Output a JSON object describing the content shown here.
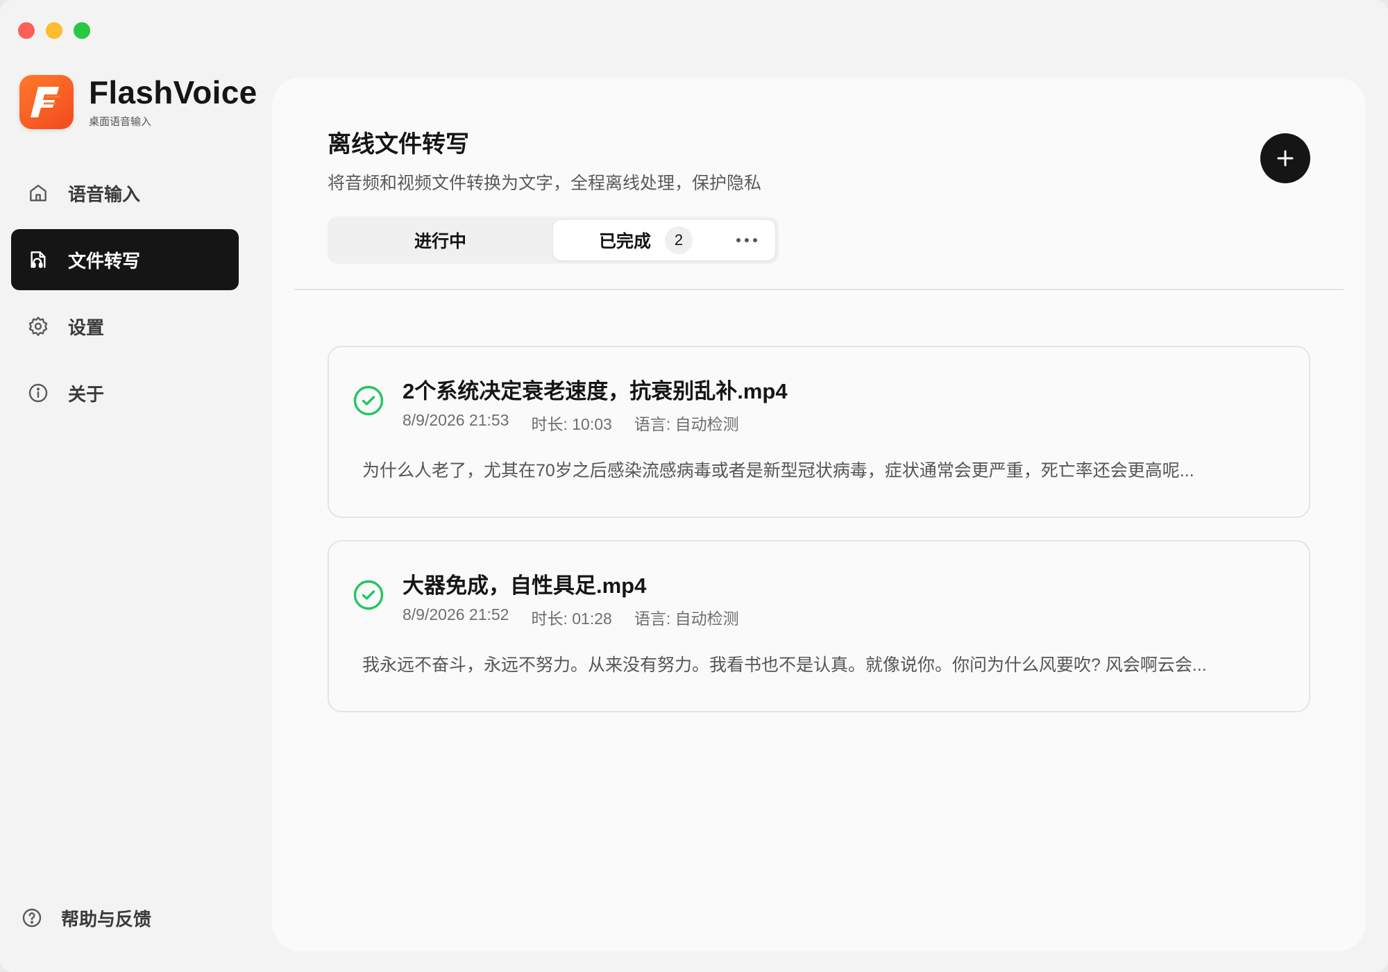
{
  "app": {
    "name": "FlashVoice",
    "tagline": "桌面语音输入"
  },
  "sidebar": {
    "items": [
      {
        "label": "语音输入",
        "icon": "home-icon",
        "active": false
      },
      {
        "label": "文件转写",
        "icon": "file-audio-icon",
        "active": true
      },
      {
        "label": "设置",
        "icon": "gear-icon",
        "active": false
      },
      {
        "label": "关于",
        "icon": "info-icon",
        "active": false
      }
    ],
    "help": {
      "label": "帮助与反馈",
      "icon": "help-icon"
    }
  },
  "main": {
    "title": "离线文件转写",
    "subtitle": "将音频和视频文件转换为文字，全程离线处理，保护隐私",
    "add_icon": "plus-icon",
    "tabs": [
      {
        "label": "进行中"
      },
      {
        "label": "已完成",
        "count": "2"
      }
    ],
    "more_icon": "more-icon"
  },
  "files": [
    {
      "name": "2个系统决定衰老速度，抗衰别乱补.mp4",
      "date": "8/9/2026 21:53",
      "duration": "时长: 10:03",
      "language": "语言: 自动检测",
      "preview": "为什么人老了，尤其在70岁之后感染流感病毒或者是新型冠状病毒，症状通常会更严重，死亡率还会更高呢..."
    },
    {
      "name": "大器免成，自性具足.mp4",
      "date": "8/9/2026 21:52",
      "duration": "时长: 01:28",
      "language": "语言: 自动检测",
      "preview": "我永远不奋斗，永远不努力。从来没有努力。我看书也不是认真。就像说你。你问为什么风要吹? 风会啊云会..."
    }
  ],
  "colors": {
    "accent": "#151515",
    "success": "#22c55e",
    "logo": "#f24a1e"
  }
}
